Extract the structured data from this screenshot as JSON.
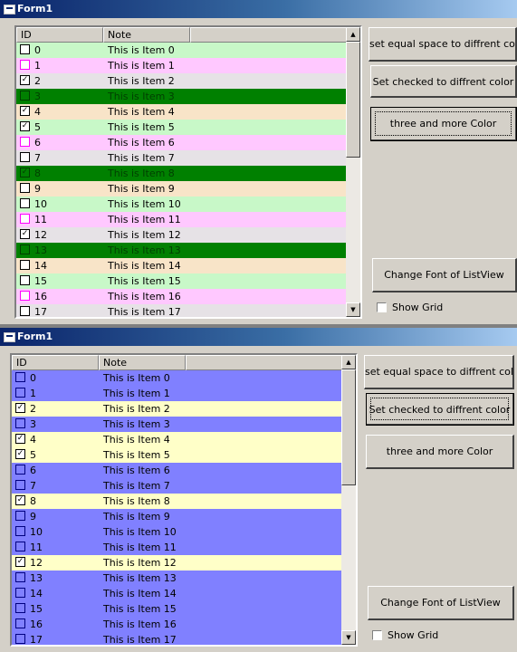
{
  "colors": {
    "titlebar_start": "#0a246a",
    "titlebar_end": "#a6caf0",
    "green": "#c8f8c8",
    "pink": "#ffc8ff",
    "light": "#e0e0e0",
    "peach": "#f8e4c8",
    "dark_green": "#008000",
    "blue": "#8080ff",
    "light_yellow": "#ffffc8",
    "face": "#d4d0c8"
  },
  "icons": {
    "checkbox_checked": "check-mark",
    "form_icon": "window-icon",
    "scroll_up": "up-arrow-icon",
    "scroll_down": "down-arrow-icon"
  },
  "windows": [
    {
      "title": "Form1",
      "columns": [
        "ID",
        "Note"
      ],
      "rows": [
        {
          "id": "0",
          "note": "This is Item 0",
          "checked": false,
          "bg": "#c8f8c8",
          "fg": "#000000",
          "cb": "#000000"
        },
        {
          "id": "1",
          "note": "This is Item 1",
          "checked": false,
          "bg": "#ffc8ff",
          "fg": "#000000",
          "cb": "#ff00ff"
        },
        {
          "id": "2",
          "note": "This is Item 2",
          "checked": true,
          "bg": "#e6e2e6",
          "fg": "#000000",
          "cb": "#000000"
        },
        {
          "id": "3",
          "note": "This is Item 3",
          "checked": false,
          "bg": "#008000",
          "fg": "#004000",
          "cb": "#004000"
        },
        {
          "id": "4",
          "note": "This is Item 4",
          "checked": true,
          "bg": "#f8e4c8",
          "fg": "#000000",
          "cb": "#000000"
        },
        {
          "id": "5",
          "note": "This is Item 5",
          "checked": true,
          "bg": "#c8f8c8",
          "fg": "#000000",
          "cb": "#000000"
        },
        {
          "id": "6",
          "note": "This is Item 6",
          "checked": false,
          "bg": "#ffc8ff",
          "fg": "#000000",
          "cb": "#ff00ff"
        },
        {
          "id": "7",
          "note": "This is Item 7",
          "checked": false,
          "bg": "#e6e2e6",
          "fg": "#000000",
          "cb": "#000000"
        },
        {
          "id": "8",
          "note": "This is Item 8",
          "checked": true,
          "bg": "#008000",
          "fg": "#004000",
          "cb": "#004000"
        },
        {
          "id": "9",
          "note": "This is Item 9",
          "checked": false,
          "bg": "#f8e4c8",
          "fg": "#000000",
          "cb": "#000000"
        },
        {
          "id": "10",
          "note": "This is Item 10",
          "checked": false,
          "bg": "#c8f8c8",
          "fg": "#000000",
          "cb": "#000000"
        },
        {
          "id": "11",
          "note": "This is Item 11",
          "checked": false,
          "bg": "#ffc8ff",
          "fg": "#000000",
          "cb": "#ff00ff"
        },
        {
          "id": "12",
          "note": "This is Item 12",
          "checked": true,
          "bg": "#e6e2e6",
          "fg": "#000000",
          "cb": "#000000"
        },
        {
          "id": "13",
          "note": "This is Item 13",
          "checked": false,
          "bg": "#008000",
          "fg": "#004000",
          "cb": "#004000"
        },
        {
          "id": "14",
          "note": "This is Item 14",
          "checked": false,
          "bg": "#f8e4c8",
          "fg": "#000000",
          "cb": "#000000"
        },
        {
          "id": "15",
          "note": "This is Item 15",
          "checked": false,
          "bg": "#c8f8c8",
          "fg": "#000000",
          "cb": "#000000"
        },
        {
          "id": "16",
          "note": "This is Item 16",
          "checked": false,
          "bg": "#ffc8ff",
          "fg": "#000000",
          "cb": "#ff00ff"
        },
        {
          "id": "17",
          "note": "This is Item 17",
          "checked": false,
          "bg": "#e6e2e6",
          "fg": "#000000",
          "cb": "#000000"
        }
      ],
      "buttons": {
        "equal_space": "set equal space to diffrent color",
        "checked_color": "Set checked to diffrent color",
        "three_color": "three and more Color",
        "change_font": "Change Font of ListView"
      },
      "show_grid_label": "Show Grid",
      "show_grid_checked": false
    },
    {
      "title": "Form1",
      "columns": [
        "ID",
        "Note"
      ],
      "rows": [
        {
          "id": "0",
          "note": "This is Item 0",
          "checked": false,
          "bg": "#8080ff",
          "fg": "#000000",
          "cb": "#000080"
        },
        {
          "id": "1",
          "note": "This is Item 1",
          "checked": false,
          "bg": "#8080ff",
          "fg": "#000000",
          "cb": "#000080"
        },
        {
          "id": "2",
          "note": "This is Item 2",
          "checked": true,
          "bg": "#ffffc8",
          "fg": "#000000",
          "cb": "#000000"
        },
        {
          "id": "3",
          "note": "This is Item 3",
          "checked": false,
          "bg": "#8080ff",
          "fg": "#000000",
          "cb": "#000080"
        },
        {
          "id": "4",
          "note": "This is Item 4",
          "checked": true,
          "bg": "#ffffc8",
          "fg": "#000000",
          "cb": "#000000"
        },
        {
          "id": "5",
          "note": "This is Item 5",
          "checked": true,
          "bg": "#ffffc8",
          "fg": "#000000",
          "cb": "#000000"
        },
        {
          "id": "6",
          "note": "This is Item 6",
          "checked": false,
          "bg": "#8080ff",
          "fg": "#000000",
          "cb": "#000080"
        },
        {
          "id": "7",
          "note": "This is Item 7",
          "checked": false,
          "bg": "#8080ff",
          "fg": "#000000",
          "cb": "#000080"
        },
        {
          "id": "8",
          "note": "This is Item 8",
          "checked": true,
          "bg": "#ffffc8",
          "fg": "#000000",
          "cb": "#000000"
        },
        {
          "id": "9",
          "note": "This is Item 9",
          "checked": false,
          "bg": "#8080ff",
          "fg": "#000000",
          "cb": "#000080"
        },
        {
          "id": "10",
          "note": "This is Item 10",
          "checked": false,
          "bg": "#8080ff",
          "fg": "#000000",
          "cb": "#000080"
        },
        {
          "id": "11",
          "note": "This is Item 11",
          "checked": false,
          "bg": "#8080ff",
          "fg": "#000000",
          "cb": "#000080"
        },
        {
          "id": "12",
          "note": "This is Item 12",
          "checked": true,
          "bg": "#ffffc8",
          "fg": "#000000",
          "cb": "#000000"
        },
        {
          "id": "13",
          "note": "This is Item 13",
          "checked": false,
          "bg": "#8080ff",
          "fg": "#000000",
          "cb": "#000080"
        },
        {
          "id": "14",
          "note": "This is Item 14",
          "checked": false,
          "bg": "#8080ff",
          "fg": "#000000",
          "cb": "#000080"
        },
        {
          "id": "15",
          "note": "This is Item 15",
          "checked": false,
          "bg": "#8080ff",
          "fg": "#000000",
          "cb": "#000080"
        },
        {
          "id": "16",
          "note": "This is Item 16",
          "checked": false,
          "bg": "#8080ff",
          "fg": "#000000",
          "cb": "#000080"
        },
        {
          "id": "17",
          "note": "This is Item 17",
          "checked": false,
          "bg": "#8080ff",
          "fg": "#000000",
          "cb": "#000080"
        }
      ],
      "buttons": {
        "equal_space": "set equal space to diffrent color",
        "checked_color": "Set checked to diffrent color",
        "three_color": "three and more Color",
        "change_font": "Change Font of ListView"
      },
      "show_grid_label": "Show Grid",
      "show_grid_checked": false
    }
  ]
}
